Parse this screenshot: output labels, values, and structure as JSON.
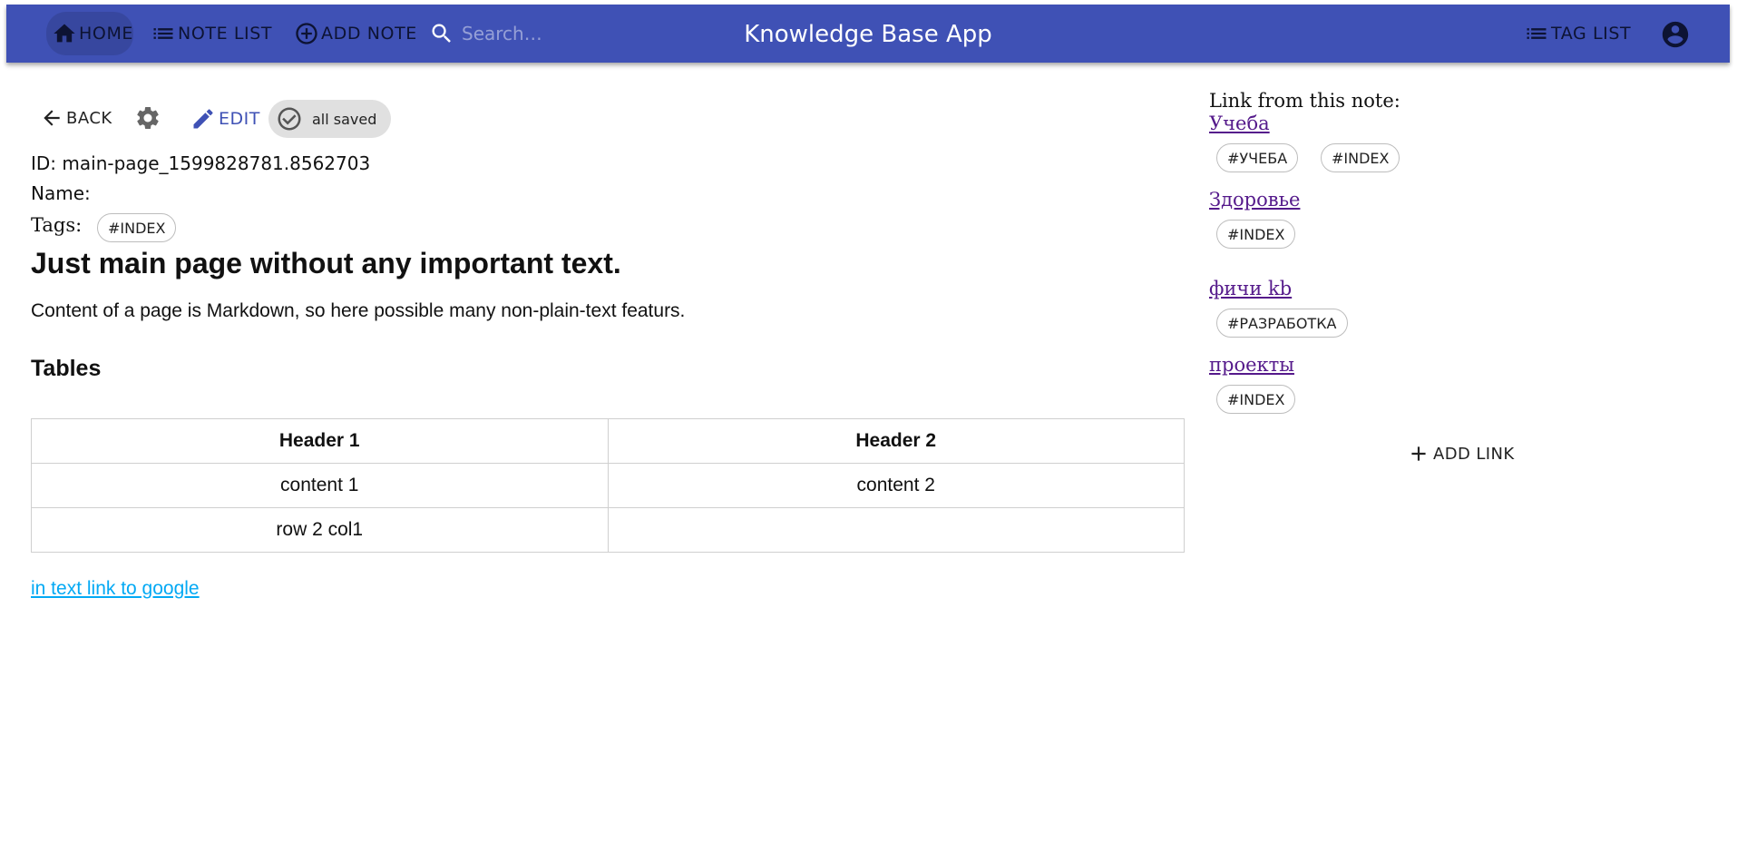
{
  "header": {
    "home_label": "HOME",
    "note_list_label": "NOTE LIST",
    "add_note_label": "ADD NOTE",
    "search_placeholder": "Search…",
    "title": "Knowledge Base App",
    "tag_list_label": "TAG LIST",
    "bar_color": "#3f51b5"
  },
  "toolbar": {
    "back_label": "BACK",
    "edit_label": "EDIT",
    "save_status": "all saved",
    "accent_color": "#3f51b5"
  },
  "note": {
    "id_line": "ID: main-page_1599828781.8562703",
    "name_line": "Name:",
    "tags_label": "Tags:",
    "tags": [
      "#INDEX"
    ]
  },
  "content": {
    "heading": "Just main page without any important text.",
    "paragraph": "Content of a page is Markdown, so here possible many non-plain-text featurs.",
    "section_heading": "Tables",
    "table": {
      "headers": [
        "Header 1",
        "Header 2"
      ],
      "rows": [
        [
          "content 1",
          "content 2"
        ],
        [
          "row 2 col1",
          ""
        ]
      ]
    },
    "link_text": "in text link to google",
    "link_color": "#03a9f4"
  },
  "links_panel": {
    "title": "Link from this note:",
    "links": [
      {
        "title": "Учеба",
        "tags": [
          "#УЧЕБА",
          "#INDEX"
        ]
      },
      {
        "title": "Здоровье",
        "tags": [
          "#INDEX"
        ]
      },
      {
        "title": "фичи kb",
        "tags": [
          "#РАЗРАБОТКА"
        ]
      },
      {
        "title": "проекты",
        "tags": [
          "#INDEX"
        ]
      }
    ],
    "add_link_label": "ADD LINK",
    "link_color": "#551a8b"
  }
}
